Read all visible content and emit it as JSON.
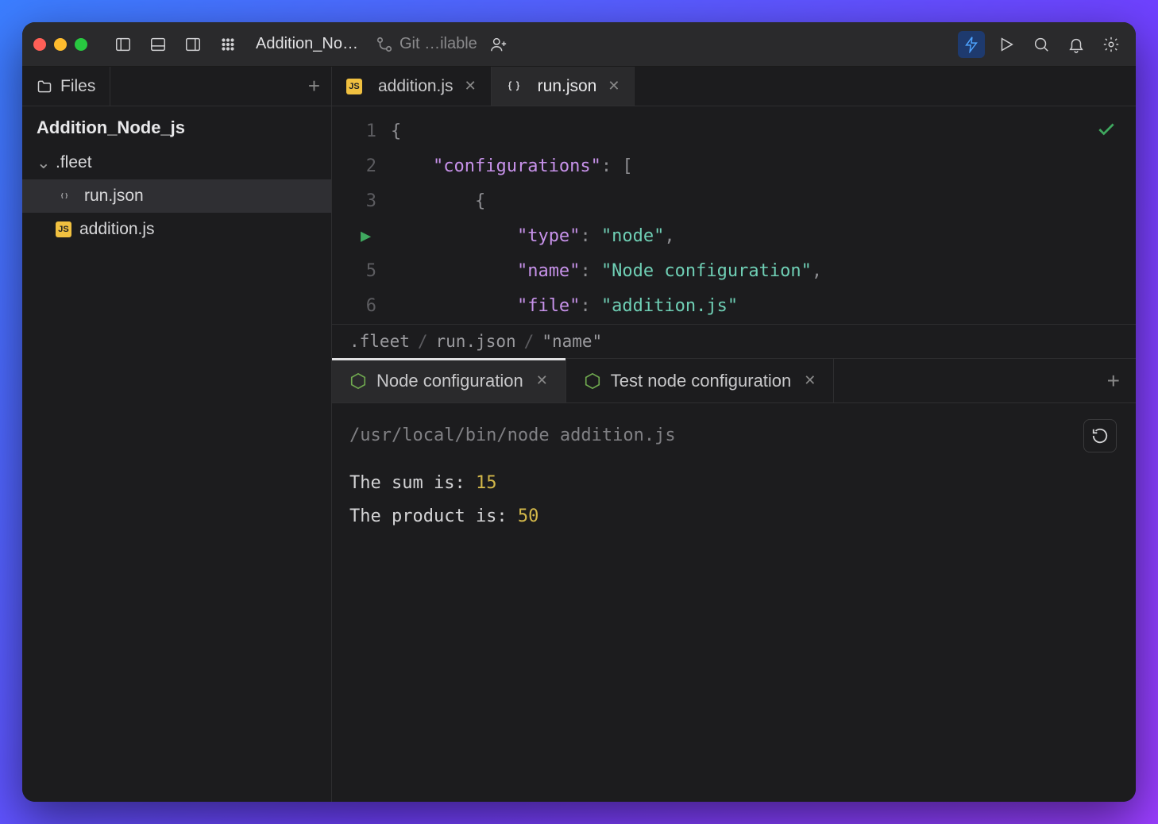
{
  "titlebar": {
    "window_title": "Addition_No…",
    "git_label": "Git …ilable"
  },
  "sidebar": {
    "tab_label": "Files",
    "project_name": "Addition_Node_js",
    "tree": {
      "folder": ".fleet",
      "folder_child": "run.json",
      "file": "addition.js"
    }
  },
  "editor_tabs": [
    {
      "label": "addition.js",
      "active": false,
      "icon": "js"
    },
    {
      "label": "run.json",
      "active": true,
      "icon": "json"
    }
  ],
  "code": {
    "l1_brace": "{",
    "l2_key": "\"configurations\"",
    "l2_colon": ": ",
    "l2_br": "[",
    "l3_brace": "{",
    "l4_key": "\"type\"",
    "l4_val": "\"node\"",
    "l5_key": "\"name\"",
    "l5_val": "\"Node configuration\"",
    "l6_key": "\"file\"",
    "l6_val": "\"addition.js\"",
    "comma": ",",
    "colon": ": "
  },
  "breadcrumb": {
    "a": ".fleet",
    "b": "run.json",
    "c": "\"name\""
  },
  "runtabs": [
    {
      "label": "Node configuration",
      "active": true
    },
    {
      "label": "Test node configuration",
      "active": false
    }
  ],
  "terminal": {
    "cmd": "/usr/local/bin/node addition.js",
    "line1_text": "The sum is: ",
    "line1_val": "15",
    "line2_text": "The product is: ",
    "line2_val": "50"
  },
  "line_numbers": [
    "1",
    "2",
    "3",
    " ",
    "5",
    "6"
  ]
}
